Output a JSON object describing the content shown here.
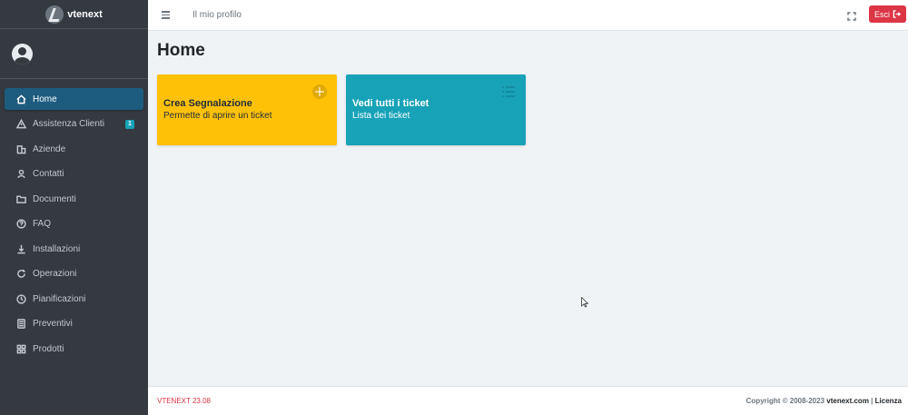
{
  "brand": {
    "name": "vtenext"
  },
  "sidebar": {
    "items": [
      {
        "label": "Home",
        "icon": "home-icon",
        "active": true
      },
      {
        "label": "Assistenza Clienti",
        "icon": "warning-icon",
        "badge": "1"
      },
      {
        "label": "Aziende",
        "icon": "building-icon"
      },
      {
        "label": "Contatti",
        "icon": "user-icon"
      },
      {
        "label": "Documenti",
        "icon": "folder-icon"
      },
      {
        "label": "FAQ",
        "icon": "question-icon"
      },
      {
        "label": "Installazioni",
        "icon": "download-icon"
      },
      {
        "label": "Operazioni",
        "icon": "refresh-icon"
      },
      {
        "label": "Pianificazioni",
        "icon": "clock-icon"
      },
      {
        "label": "Preventivi",
        "icon": "calculator-icon"
      },
      {
        "label": "Prodotti",
        "icon": "grid-icon"
      }
    ]
  },
  "header": {
    "profile_link": "Il mio profilo",
    "logout_label": "Esci"
  },
  "main": {
    "title": "Home",
    "cards": [
      {
        "title": "Crea Segnalazione",
        "subtitle": "Permette di aprire un ticket",
        "icon": "plus-circle-icon",
        "color": "#ffc107"
      },
      {
        "title": "Vedi tutti i ticket",
        "subtitle": "Lista dei ticket",
        "icon": "list-icon",
        "color": "#17a2b8"
      }
    ]
  },
  "footer": {
    "version": "VTENEXT 23.08",
    "copyright_prefix": "Copyright © 2008-2023",
    "copyright_site": "vtenext.com",
    "separator": "|",
    "license": "Licenza"
  },
  "colors": {
    "sidebar": "#343a40",
    "active": "#1d5c7f",
    "danger": "#dc3545",
    "warning": "#ffc107",
    "info": "#17a2b8"
  }
}
